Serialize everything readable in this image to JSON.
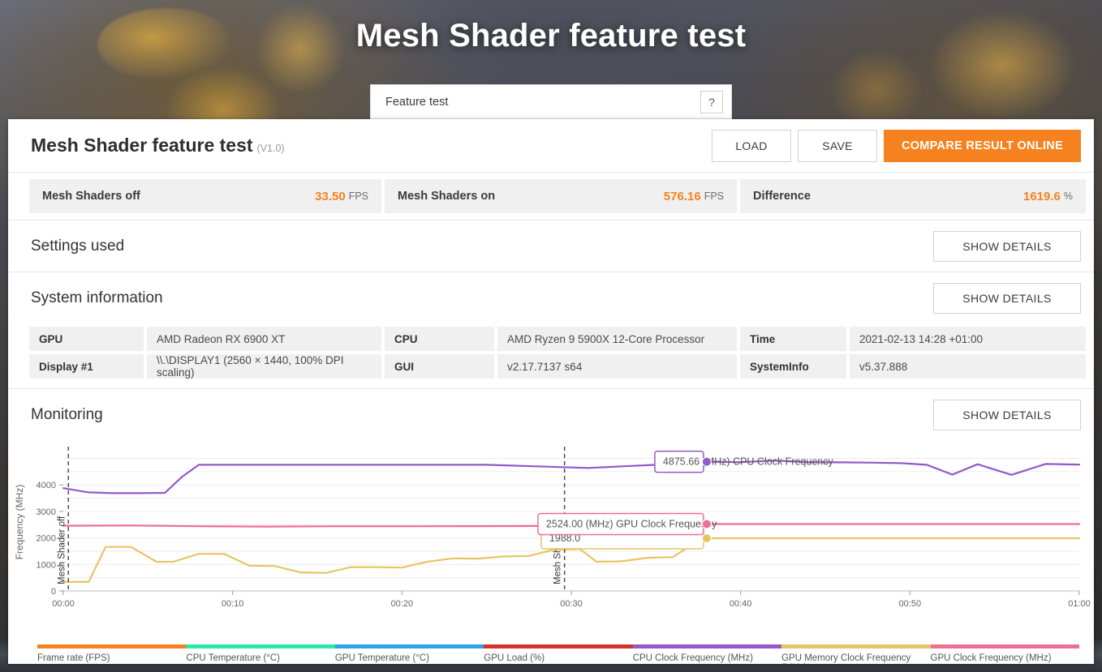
{
  "hero": {
    "title": "Mesh Shader feature test"
  },
  "featurebar": {
    "label": "Feature test",
    "help": "?"
  },
  "result": {
    "title": "Mesh Shader feature test",
    "version": "(V1.0)",
    "load_label": "LOAD",
    "save_label": "SAVE",
    "compare_label": "COMPARE RESULT ONLINE"
  },
  "scores": [
    {
      "name": "Mesh Shaders off",
      "value": "33.50",
      "unit": "FPS"
    },
    {
      "name": "Mesh Shaders on",
      "value": "576.16",
      "unit": "FPS"
    },
    {
      "name": "Difference",
      "value": "1619.6",
      "unit": "%"
    }
  ],
  "sections": {
    "settings_used": "Settings used",
    "system_information": "System information",
    "monitoring": "Monitoring",
    "show_details": "SHOW DETAILS"
  },
  "sysinfo": {
    "col1": [
      {
        "key": "GPU",
        "value": "AMD Radeon RX 6900 XT"
      },
      {
        "key": "Display #1",
        "value": "\\\\.\\DISPLAY1 (2560 × 1440, 100% DPI scaling)"
      }
    ],
    "col2": [
      {
        "key": "CPU",
        "value": "AMD Ryzen 9 5900X 12-Core Processor"
      },
      {
        "key": "GUI",
        "value": "v2.17.7137 s64"
      }
    ],
    "col3": [
      {
        "key": "Time",
        "value": "2021-02-13 14:28 +01:00"
      },
      {
        "key": "SystemInfo",
        "value": "v5.37.888"
      }
    ]
  },
  "chart_data": {
    "type": "line",
    "title": "Monitoring",
    "xlabel": "",
    "ylabel": "Frequency (MHz)",
    "ylim": [
      0,
      5200
    ],
    "yticks": [
      0,
      1000,
      2000,
      3000,
      4000
    ],
    "xticks": [
      "00:00",
      "00:10",
      "00:20",
      "00:30",
      "00:40",
      "00:50",
      "01:00"
    ],
    "xlim_seconds": [
      0,
      60
    ],
    "grid": true,
    "legend_position": "bottom",
    "legend": [
      {
        "name": "Frame rate (FPS)",
        "color": "#f5821f"
      },
      {
        "name": "CPU Temperature (°C)",
        "color": "#2ce8a8"
      },
      {
        "name": "GPU Temperature (°C)",
        "color": "#2fa5e8"
      },
      {
        "name": "GPU Load (%)",
        "color": "#d6322c"
      },
      {
        "name": "CPU Clock Frequency (MHz)",
        "color": "#9458c8"
      },
      {
        "name": "GPU Memory Clock Frequency (MHz)",
        "color": "#e8c464"
      },
      {
        "name": "GPU Clock Frequency (MHz)",
        "color": "#ef6f92"
      }
    ],
    "series": [
      {
        "name": "CPU Clock Frequency (MHz)",
        "color": "#9458c8",
        "x": [
          0,
          1.5,
          3,
          4.5,
          6,
          7,
          8,
          10,
          13,
          16,
          19,
          22,
          25,
          28,
          31,
          33,
          35,
          36,
          37,
          38,
          40,
          42,
          44,
          46,
          48,
          49.5,
          51,
          52.5,
          54,
          56,
          58,
          60
        ],
        "values": [
          3880,
          3720,
          3690,
          3690,
          3700,
          4300,
          4760,
          4760,
          4760,
          4760,
          4760,
          4760,
          4760,
          4700,
          4640,
          4700,
          4760,
          4760,
          4790,
          4875.66,
          4860,
          4920,
          4860,
          4850,
          4840,
          4820,
          4760,
          4390,
          4780,
          4380,
          4790,
          4770
        ]
      },
      {
        "name": "GPU Clock Frequency (MHz)",
        "color": "#ef6f92",
        "x": [
          0,
          4,
          8,
          12,
          16,
          20,
          24,
          28,
          32,
          34,
          36,
          37,
          38,
          44,
          50,
          56,
          60
        ],
        "values": [
          2460,
          2470,
          2440,
          2430,
          2440,
          2440,
          2445,
          2450,
          2455,
          2470,
          2490,
          2510,
          2524,
          2524,
          2524,
          2524,
          2524
        ]
      },
      {
        "name": "GPU Memory Clock Frequency (MHz)",
        "color": "#e8c464",
        "x": [
          0,
          1.5,
          2.5,
          4,
          5.5,
          6.5,
          8,
          9.5,
          11,
          12.5,
          14,
          15.5,
          17,
          18.5,
          20,
          21.5,
          23,
          24.5,
          26,
          27.5,
          29,
          30.5,
          31.5,
          33,
          34.5,
          36,
          37,
          38,
          44,
          50,
          56,
          60
        ],
        "values": [
          340,
          340,
          1660,
          1660,
          1100,
          1100,
          1400,
          1400,
          950,
          940,
          700,
          680,
          900,
          900,
          880,
          1100,
          1230,
          1220,
          1300,
          1320,
          1560,
          1580,
          1100,
          1120,
          1250,
          1280,
          1700,
          1988,
          1988,
          1988,
          1988,
          1988
        ]
      }
    ],
    "markers": [
      {
        "label": "Mesh Shader off",
        "x_seconds": 0.3
      },
      {
        "label": "Mesh Shader",
        "x_seconds": 29.6
      }
    ],
    "tooltips": [
      {
        "text": "4875.66 (MHz) CPU Clock Frequency",
        "color": "#9458c8",
        "x_seconds": 38.0,
        "value": 4875.66
      },
      {
        "text": "2524.00 (MHz) GPU Clock Frequency",
        "color": "#ef6f92",
        "x_seconds": 38.0,
        "value": 2524.0
      },
      {
        "text": "1988.0",
        "color": "#e8c464",
        "x_seconds": 38.0,
        "value": 1988.0
      }
    ]
  }
}
